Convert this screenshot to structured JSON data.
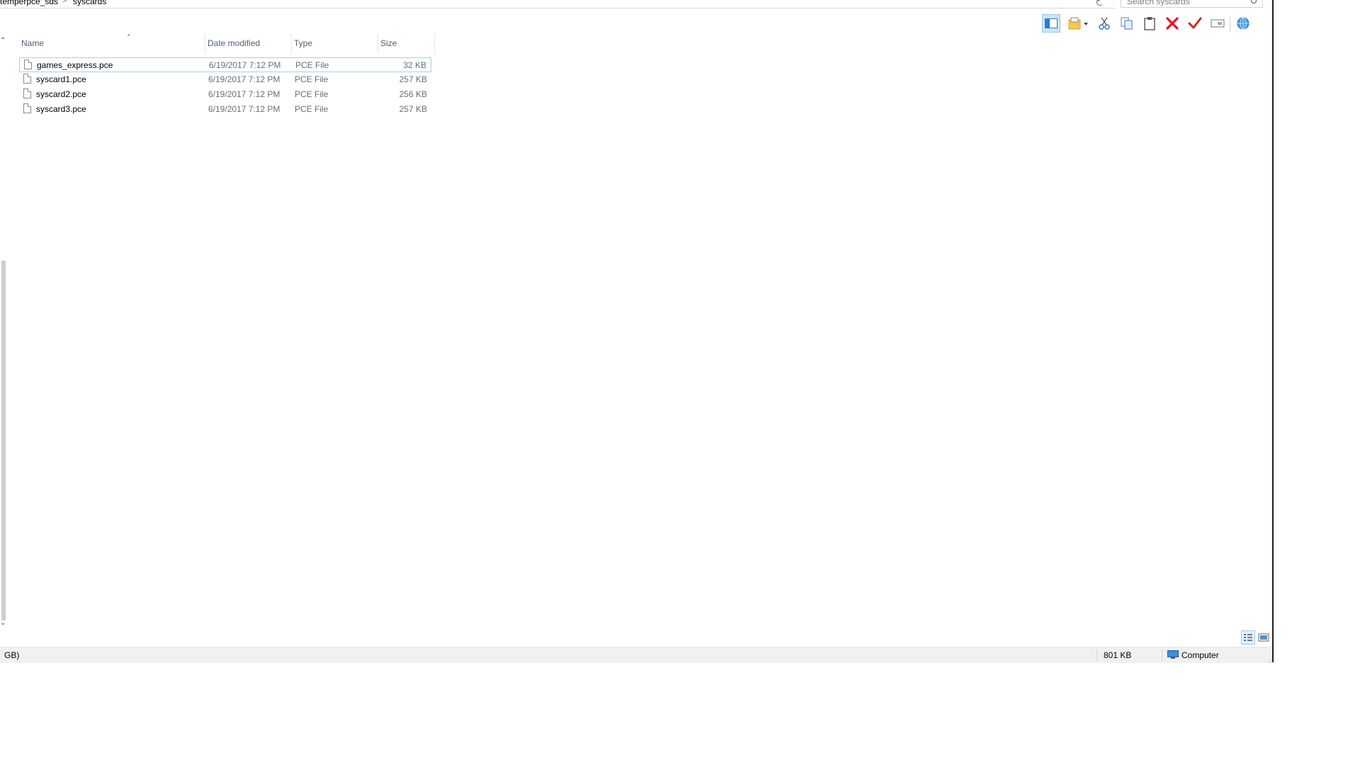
{
  "address": {
    "crumbs": [
      "temperpce_sds",
      "syscards"
    ],
    "separator": ">"
  },
  "search": {
    "placeholder": "Search syscards"
  },
  "toolbar": {
    "buttons": [
      "preview-pane",
      "new-folder",
      "cut",
      "copy",
      "paste",
      "delete",
      "apply",
      "rename",
      "web"
    ]
  },
  "columns": {
    "name": "Name",
    "date": "Date modified",
    "type": "Type",
    "size": "Size"
  },
  "files": [
    {
      "name": "games_express.pce",
      "date": "6/19/2017 7:12 PM",
      "type": "PCE File",
      "size": "32 KB"
    },
    {
      "name": "syscard1.pce",
      "date": "6/19/2017 7:12 PM",
      "type": "PCE File",
      "size": "257 KB"
    },
    {
      "name": "syscard2.pce",
      "date": "6/19/2017 7:12 PM",
      "type": "PCE File",
      "size": "256 KB"
    },
    {
      "name": "syscard3.pce",
      "date": "6/19/2017 7:12 PM",
      "type": "PCE File",
      "size": "257 KB"
    }
  ],
  "status": {
    "left": "GB)",
    "total_size": "801 KB",
    "location": "Computer"
  },
  "colors": {
    "accent": "#0078d7",
    "delete": "#e81123",
    "apply": "#cc2a1d",
    "selection_border": "#99d1ff"
  }
}
